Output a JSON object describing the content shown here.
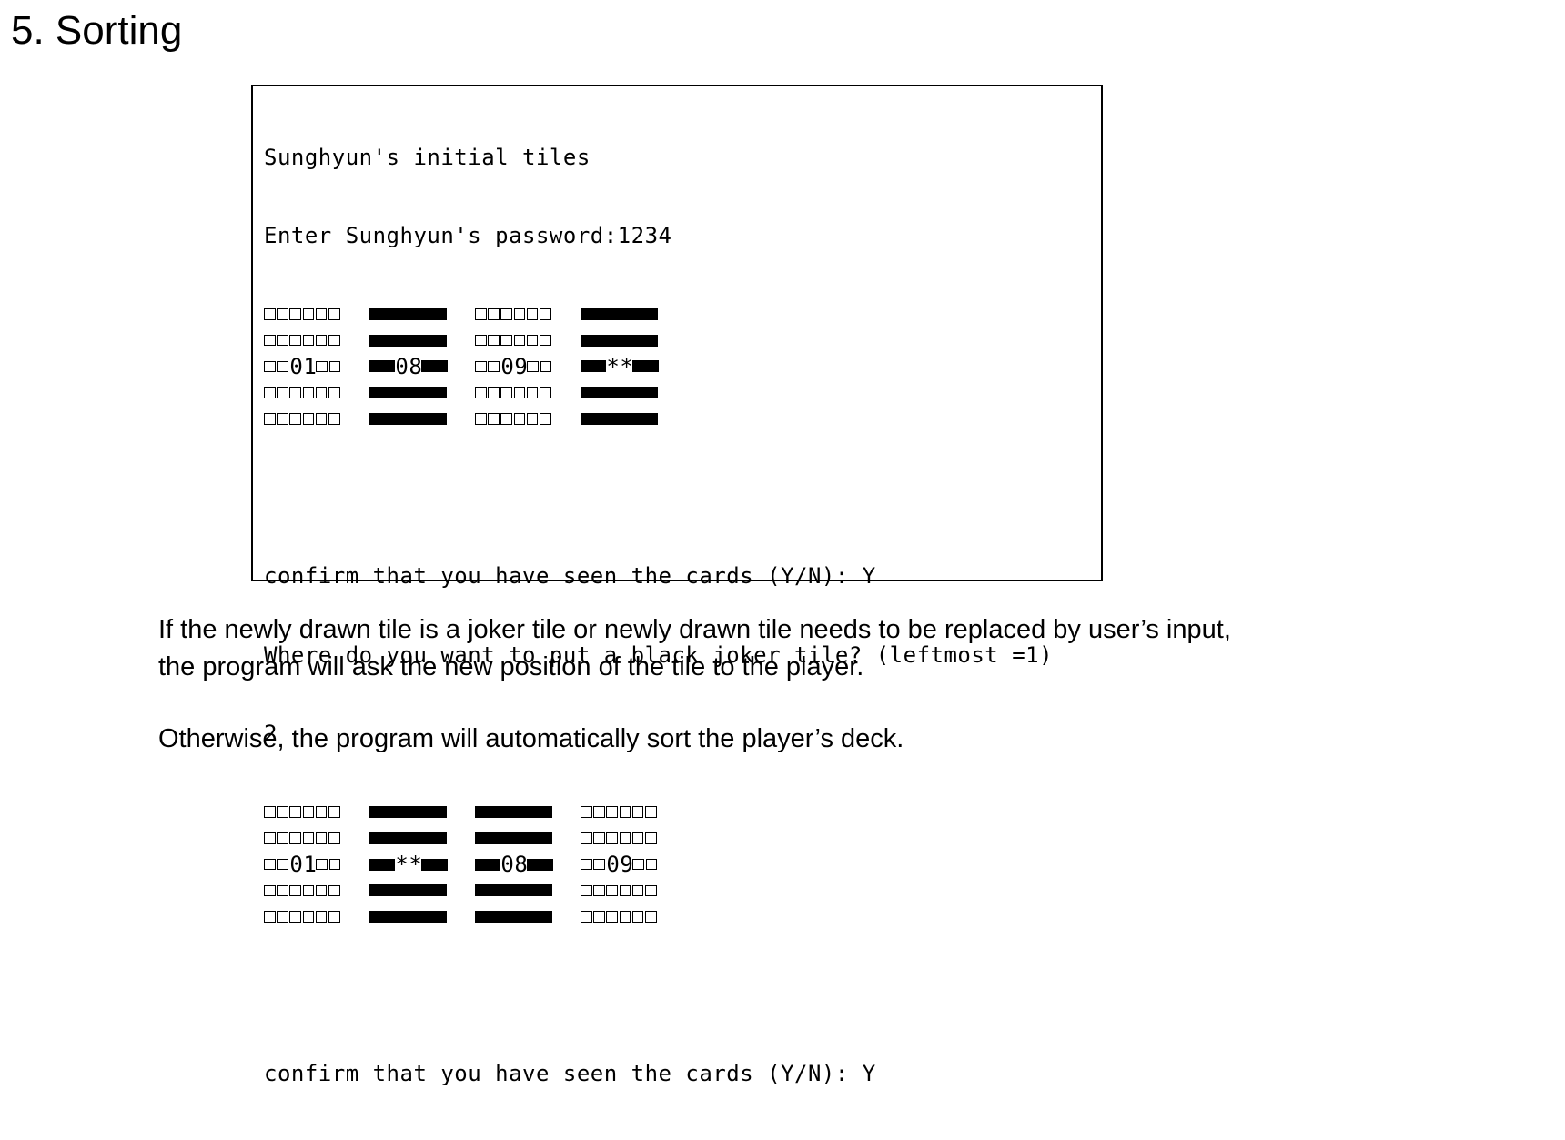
{
  "heading": "5. Sorting",
  "console": {
    "header_lines": [
      "Sunghyun's initial tiles",
      "Enter Sunghyun's password:1234"
    ],
    "deck1": [
      {
        "color": "white",
        "label": "01"
      },
      {
        "color": "black",
        "label": "08"
      },
      {
        "color": "white",
        "label": "09"
      },
      {
        "color": "black",
        "label": "**"
      }
    ],
    "confirm1": "confirm that you have seen the cards (Y/N): Y",
    "joker_prompt": "Where do you want to put a black joker tile? (leftmost =1)",
    "joker_answer": "2",
    "deck2": [
      {
        "color": "white",
        "label": "01"
      },
      {
        "color": "black",
        "label": "**"
      },
      {
        "color": "black",
        "label": "08"
      },
      {
        "color": "white",
        "label": "09"
      }
    ],
    "confirm2": "confirm that you have seen the cards (Y/N): Y"
  },
  "description": {
    "line1": "If the newly drawn tile is a joker tile or newly drawn tile needs to be replaced by user’s input,",
    "line2": "the program will ask the new position of the tile to the player.",
    "line3": "Otherwise, the program will automatically sort the player’s deck."
  }
}
